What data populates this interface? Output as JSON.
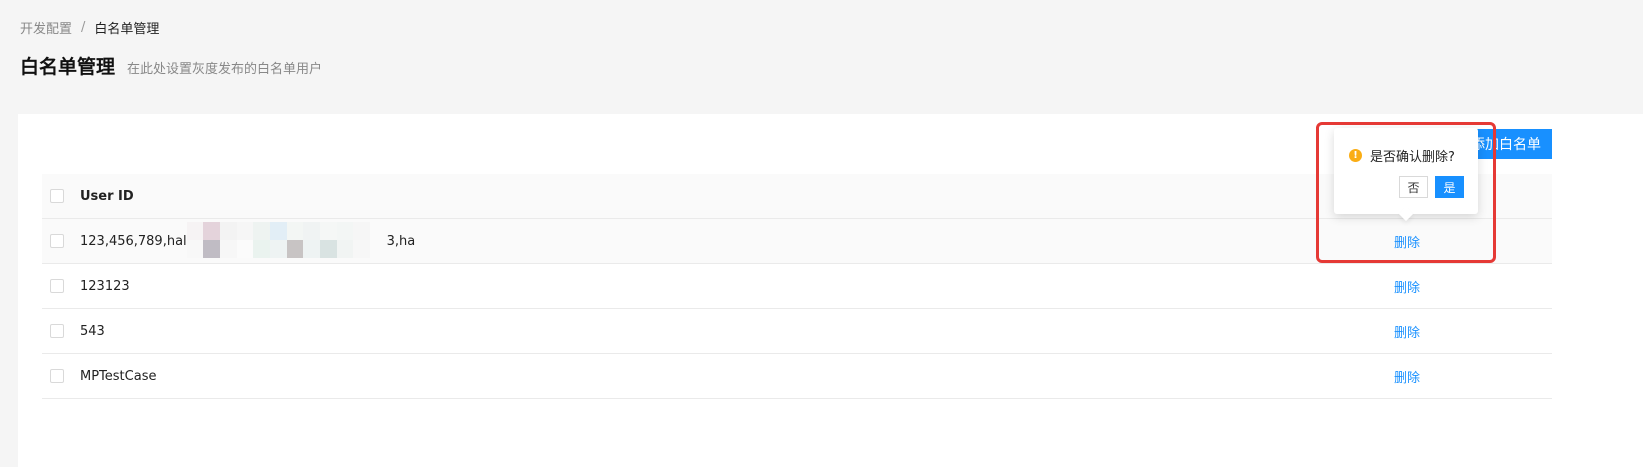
{
  "breadcrumb": {
    "parent": "开发配置",
    "separator": "/",
    "current": "白名单管理"
  },
  "header": {
    "title": "白名单管理",
    "subtitle": "在此处设置灰度发布的白名单用户"
  },
  "toolbar": {
    "add_label": "添加白名单"
  },
  "table": {
    "columns": [
      "User ID"
    ],
    "rows": [
      {
        "user_id_prefix": "123,456,789,hal",
        "user_id_suffix": "3,ha",
        "action": "删除"
      },
      {
        "user_id": "123123",
        "action": "删除"
      },
      {
        "user_id": "543",
        "action": "删除"
      },
      {
        "user_id": "MPTestCase",
        "action": "删除"
      }
    ]
  },
  "popconfirm": {
    "message": "是否确认删除?",
    "cancel_label": "否",
    "ok_label": "是"
  },
  "colors": {
    "primary": "#1890ff",
    "warning": "#faad14",
    "highlight": "#e53935"
  }
}
